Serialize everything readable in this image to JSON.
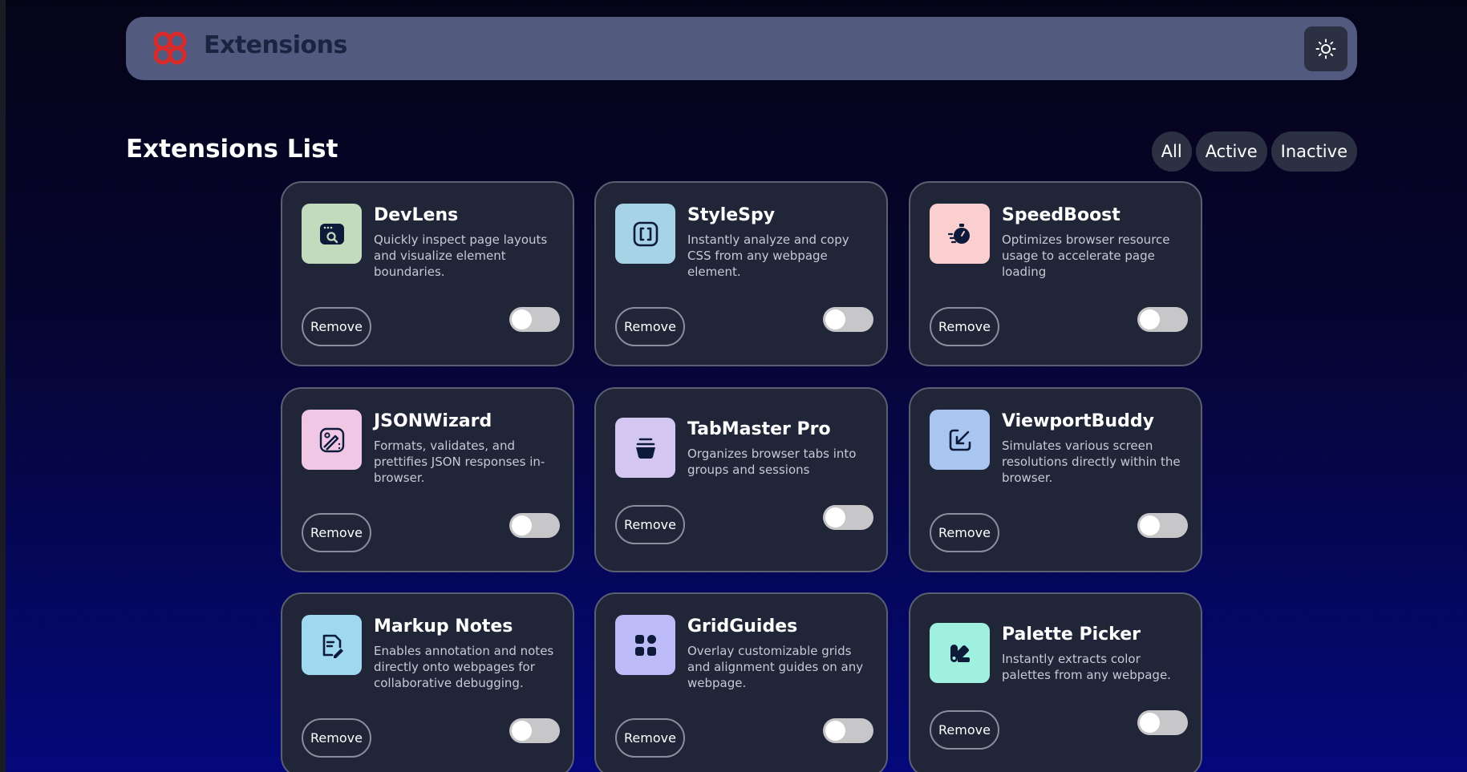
{
  "app": {
    "title": "Extensions",
    "logo_icon": "logo-icon",
    "theme_toggle_icon": "sun-icon"
  },
  "list": {
    "title": "Extensions List"
  },
  "filters": {
    "all": "All",
    "active": "Active",
    "inactive": "Inactive"
  },
  "colors": {
    "logo_red": "#d92a2a",
    "header_bg": "#535a7f",
    "card_bg": "#202538",
    "toggle_off": "#c7c7ca"
  },
  "extensions": [
    {
      "name": "DevLens",
      "description": "Quickly inspect page layouts and visualize element boundaries.",
      "remove_label": "Remove",
      "active": false,
      "icon": "browser-search-icon",
      "icon_bg": "#c3dbbd"
    },
    {
      "name": "StyleSpy",
      "description": "Instantly analyze and copy CSS from any webpage element.",
      "remove_label": "Remove",
      "active": false,
      "icon": "code-brackets-icon",
      "icon_bg": "#a6d3e5"
    },
    {
      "name": "SpeedBoost",
      "description": "Optimizes browser resource usage to accelerate page loading",
      "remove_label": "Remove",
      "active": false,
      "icon": "stopwatch-icon",
      "icon_bg": "#fbcfcf"
    },
    {
      "name": "JSONWizard",
      "description": "Formats, validates, and prettifies JSON responses in-browser.",
      "remove_label": "Remove",
      "active": false,
      "icon": "image-wand-icon",
      "icon_bg": "#f0c8e6"
    },
    {
      "name": "TabMaster Pro",
      "description": "Organizes browser tabs into groups and sessions",
      "remove_label": "Remove",
      "active": false,
      "icon": "jar-icon",
      "icon_bg": "#d3c6f0"
    },
    {
      "name": "ViewportBuddy",
      "description": "Simulates various screen resolutions directly within the browser.",
      "remove_label": "Remove",
      "active": false,
      "icon": "resize-arrow-icon",
      "icon_bg": "#a9c6f0"
    },
    {
      "name": "Markup Notes",
      "description": "Enables annotation and notes directly onto webpages for collaborative debugging.",
      "remove_label": "Remove",
      "active": false,
      "icon": "note-pen-icon",
      "icon_bg": "#9fd8ef"
    },
    {
      "name": "GridGuides",
      "description": "Overlay customizable grids and alignment guides on any webpage.",
      "remove_label": "Remove",
      "active": false,
      "icon": "grid-shapes-icon",
      "icon_bg": "#bcbaf7"
    },
    {
      "name": "Palette Picker",
      "description": "Instantly extracts color palettes from any webpage.",
      "remove_label": "Remove",
      "active": false,
      "icon": "palette-swatch-icon",
      "icon_bg": "#9ff0df"
    }
  ]
}
